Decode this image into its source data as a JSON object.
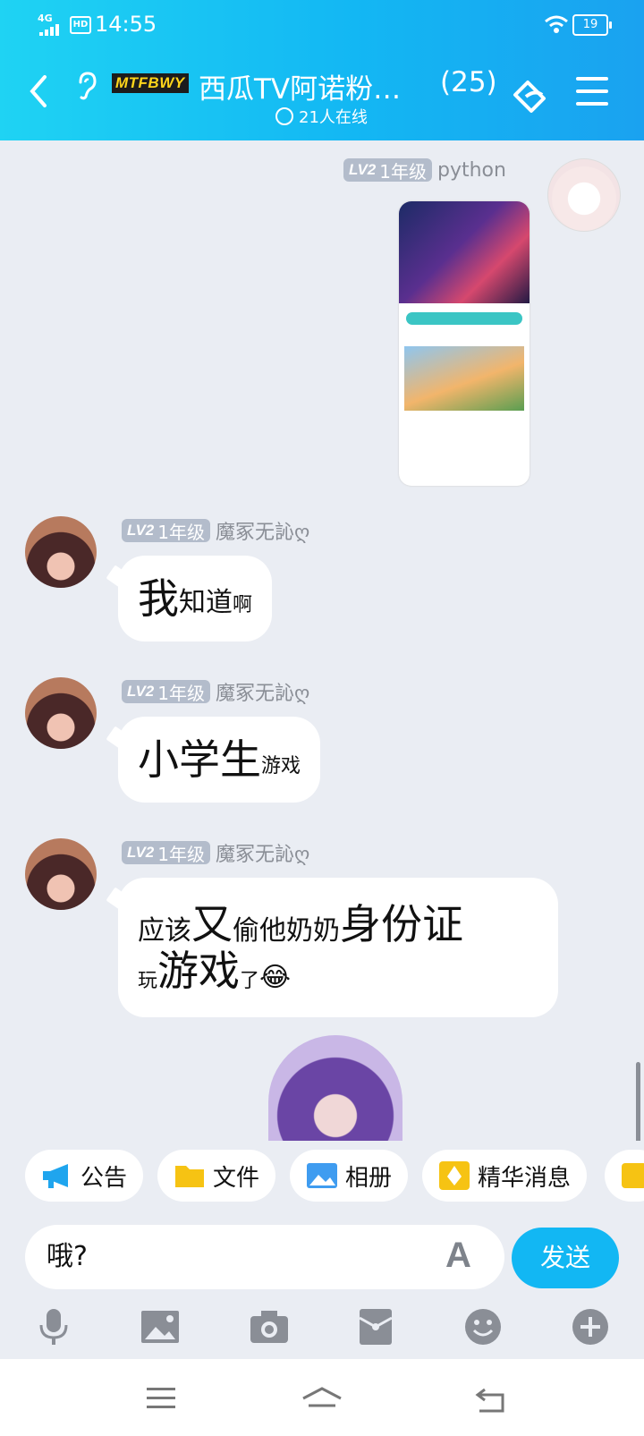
{
  "status_bar": {
    "network": "4G",
    "hd": "HD",
    "time": "14:55",
    "battery": "19"
  },
  "header": {
    "badge": "MTFBWY",
    "title": "西瓜TV阿诺粉…",
    "count": "(25)",
    "online": "21人在线"
  },
  "messages": [
    {
      "side": "right",
      "level": "LV2",
      "grade": "1年级",
      "name": "python",
      "type": "image"
    },
    {
      "side": "left",
      "level": "LV2",
      "grade": "1年级",
      "name": "魔冢无訫ღ",
      "parts": [
        "我",
        "知道",
        "啊"
      ]
    },
    {
      "side": "left",
      "level": "LV2",
      "grade": "1年级",
      "name": "魔冢无訫ღ",
      "parts": [
        "小学生",
        "游戏"
      ]
    },
    {
      "side": "left",
      "level": "LV2",
      "grade": "1年级",
      "name": "魔冢无訫ღ",
      "parts": [
        "应该",
        "又",
        "偷他奶奶",
        "身份证",
        "玩",
        "游戏",
        "了",
        "😂"
      ]
    }
  ],
  "toolbar": {
    "items": [
      "公告",
      "文件",
      "相册",
      "精华消息"
    ]
  },
  "composer": {
    "input_value": "哦?",
    "send_label": "发送"
  },
  "accent": "#12b7f3"
}
